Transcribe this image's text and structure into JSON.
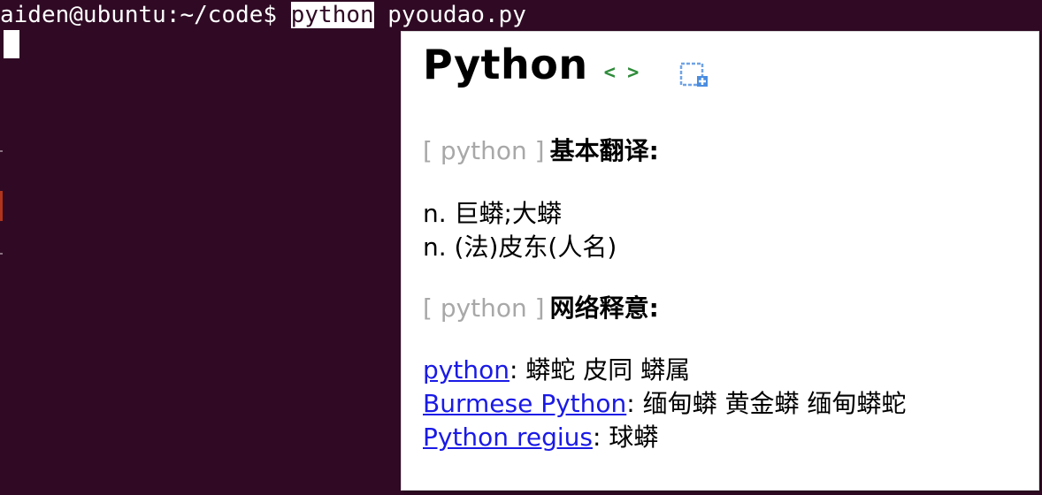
{
  "terminal": {
    "prompt": "aiden@ubuntu:~/code$ ",
    "selected_word": "python",
    "rest_of_command": " pyoudao.py"
  },
  "popup": {
    "headword": "Python",
    "pronunciation": "< >",
    "add_icon": "add-to-wordbook-icon",
    "basic": {
      "bracket": "[ python ]",
      "label": "基本翻译:",
      "lines": [
        "n. 巨蟒;大蟒",
        "n. (法)皮东(人名)"
      ]
    },
    "web": {
      "bracket": "[ python ]",
      "label": "网络释意:",
      "items": [
        {
          "term": "python",
          "meaning": ": 蟒蛇 皮同 蟒属"
        },
        {
          "term": "Burmese Python",
          "meaning": ": 缅甸蟒 黄金蟒 缅甸蟒蛇"
        },
        {
          "term": "Python regius",
          "meaning": ": 球蟒"
        }
      ]
    }
  },
  "colors": {
    "terminal_bg": "#300a24",
    "link": "#1a1ae6",
    "pronunciation": "#2e8b3a",
    "bracket_gray": "#a8a8a8"
  }
}
